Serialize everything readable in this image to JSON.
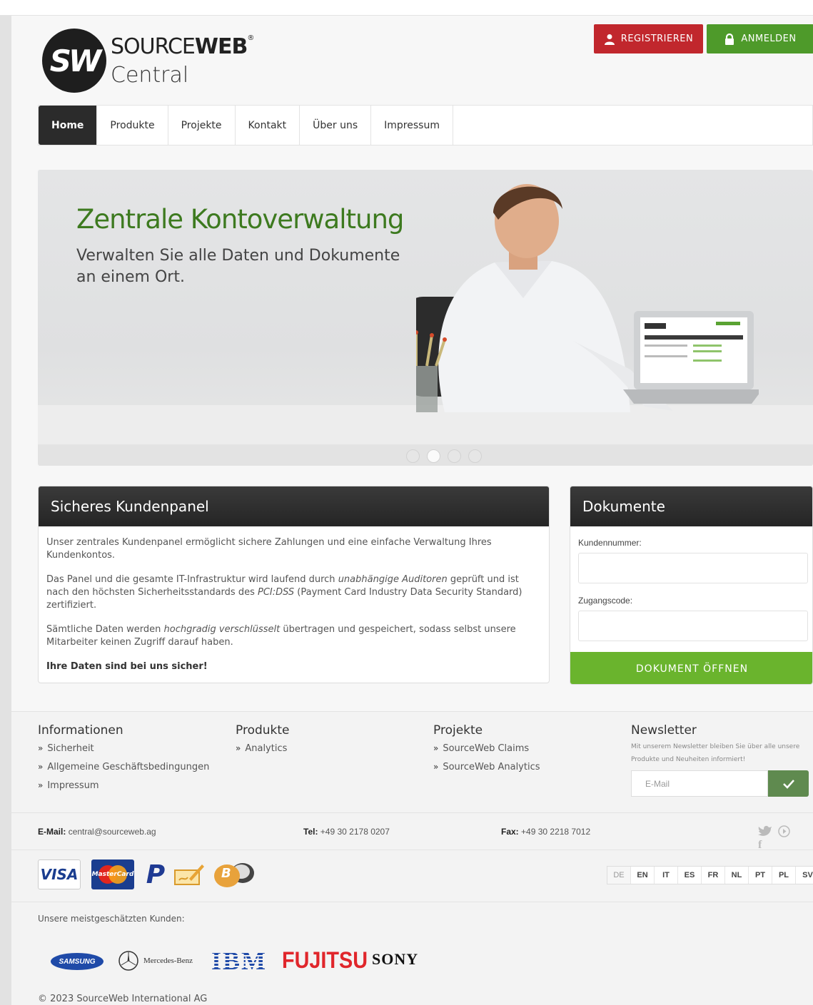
{
  "header": {
    "logo_mark": "SW",
    "logo_line1_light": "SOURCE",
    "logo_line1_bold": "WEB",
    "logo_registered": "®",
    "logo_line2": "Central",
    "register_label": "REGISTRIEREN",
    "login_label": "ANMELDEN"
  },
  "nav": {
    "items": [
      {
        "label": "Home"
      },
      {
        "label": "Produkte"
      },
      {
        "label": "Projekte"
      },
      {
        "label": "Kontakt"
      },
      {
        "label": "Über uns"
      },
      {
        "label": "Impressum"
      }
    ]
  },
  "hero": {
    "title": "Zentrale Kontoverwaltung",
    "subtitle": "Verwalten Sie alle Daten und Dokumente an einem Ort.",
    "slide_count": 4,
    "active_slide": 2
  },
  "panel_left": {
    "title": "Sicheres Kundenpanel",
    "p1": "Unser zentrales Kundenpanel ermöglicht sichere Zahlungen und eine einfache Verwaltung Ihres Kundenkontos.",
    "p2_a": "Das Panel und die gesamte IT-Infrastruktur wird laufend durch ",
    "p2_em1": "unabhängige Auditoren",
    "p2_b": " geprüft und ist nach den höchsten Sicherheitsstandards des ",
    "p2_em2": "PCI:DSS",
    "p2_c": " (Payment Card Industry Data Security Standard) zertifiziert.",
    "p3_a": "Sämtliche Daten werden ",
    "p3_em": "hochgradig verschlüsselt",
    "p3_b": " übertragen und gespeichert, sodass selbst unsere Mitarbeiter keinen Zugriff darauf haben.",
    "p4": "Ihre Daten sind bei uns sicher!"
  },
  "panel_right": {
    "title": "Dokumente",
    "field1_label": "Kundennummer:",
    "field1_value": "",
    "field2_label": "Zugangscode:",
    "field2_value": "",
    "submit_label": "DOKUMENT ÖFFNEN"
  },
  "footer": {
    "col1": {
      "title": "Informationen",
      "items": [
        "Sicherheit",
        "Allgemeine Geschäftsbedingungen",
        "Impressum"
      ]
    },
    "col2": {
      "title": "Produkte",
      "items": [
        "Analytics"
      ]
    },
    "col3": {
      "title": "Projekte",
      "items": [
        "SourceWeb Claims",
        "SourceWeb Analytics"
      ]
    },
    "newsletter": {
      "title": "Newsletter",
      "desc": "Mit unserem Newsletter bleiben Sie über alle unsere Produkte und Neuheiten informiert!",
      "placeholder": "E-Mail",
      "submit_icon": "checkmark-icon"
    },
    "contact": {
      "email_label": "E-Mail:",
      "email_value": "central@sourceweb.ag",
      "tel_label": "Tel:",
      "tel_value": "+49 30 2178 0207",
      "fax_label": "Fax:",
      "fax_value": "+49 30 2218 7012"
    },
    "social": [
      "facebook-icon",
      "twitter-icon",
      "rss-icon"
    ],
    "payments": {
      "visa": "VISA",
      "mastercard": "MasterCard",
      "paypal": "P",
      "bitcoin": "B"
    },
    "languages": [
      "DE",
      "EN",
      "IT",
      "ES",
      "FR",
      "NL",
      "PT",
      "PL",
      "SV"
    ],
    "active_language": "DE",
    "clients_label": "Unsere meistgeschätzten Kunden:",
    "clients": {
      "samsung": "SAMSUNG",
      "mercedes": "Mercedes-Benz",
      "ibm": "IBM",
      "fujitsu": "FUJITSU",
      "sony": "SONY"
    },
    "copyright": "© 2023 SourceWeb International AG"
  },
  "colors": {
    "register": "#c1272d",
    "login": "#4e9a2a",
    "hero_title": "#3d7a1f",
    "open_button": "#6ab42d",
    "panel_head": "#2b2b2b"
  }
}
